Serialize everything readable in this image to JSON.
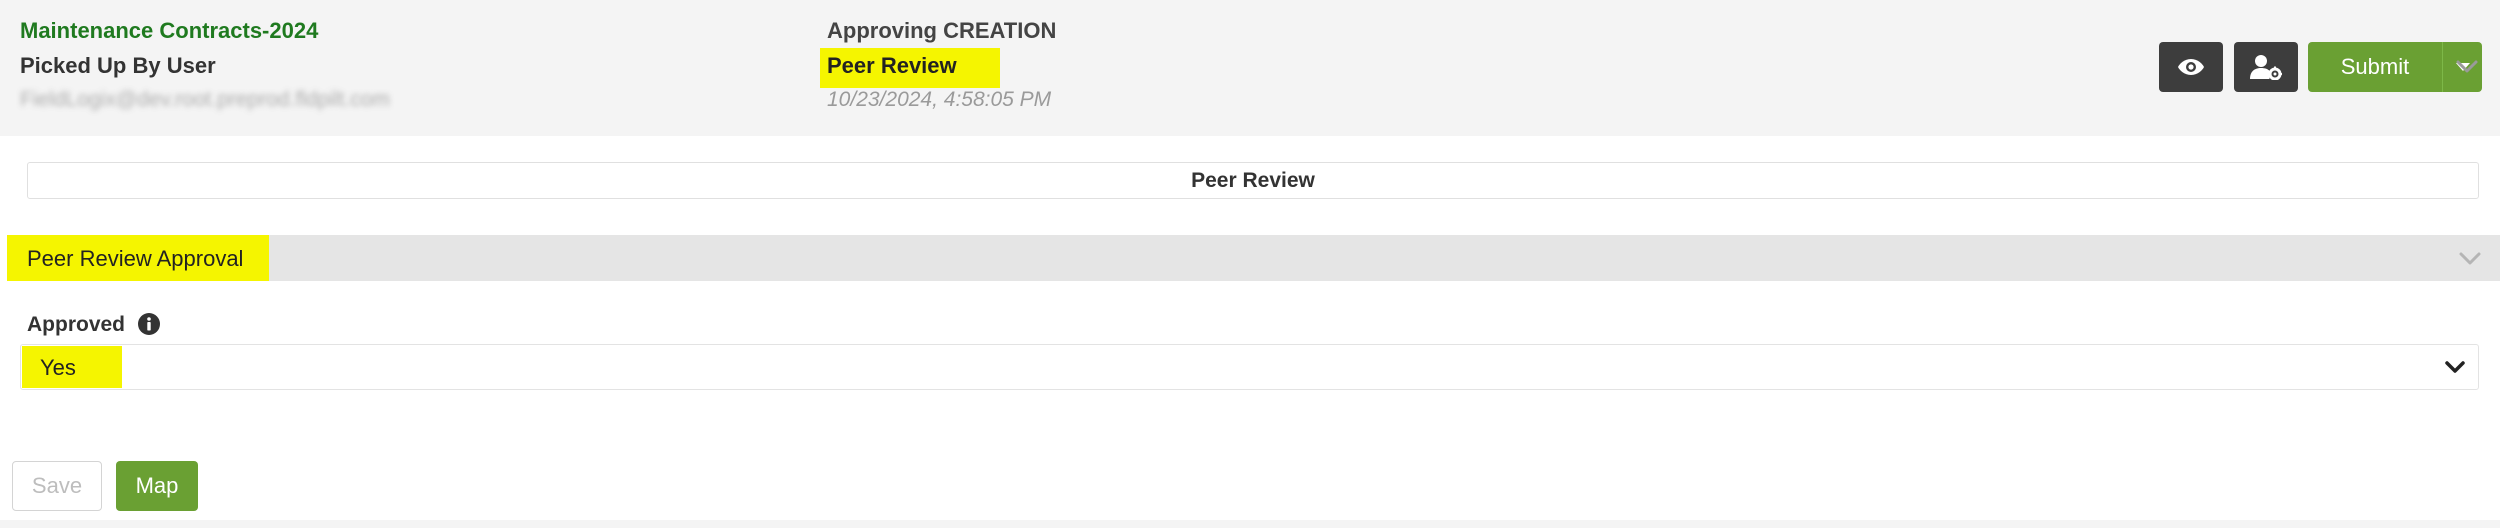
{
  "header": {
    "workflow_title": "Maintenance Contracts-2024",
    "status": "Picked Up By User",
    "user_email": "FieldLogix@dev.root.preprod.fldpilt.com",
    "approving_label": "Approving CREATION",
    "step_name": "Peer Review",
    "timestamp": "10/23/2024, 4:58:05 PM",
    "view_icon": "eye-icon",
    "reassign_icon": "user-gear-icon",
    "submit_label": "Submit"
  },
  "step_bar": {
    "label": "Peer Review"
  },
  "section": {
    "title": "Peer Review Approval"
  },
  "field": {
    "label": "Approved",
    "value": "Yes",
    "info_icon": "info-icon"
  },
  "footer": {
    "save_label": "Save",
    "map_label": "Map"
  },
  "colors": {
    "accent_green": "#6aa033",
    "title_green": "#1f7a1f",
    "dark_button": "#3d3d3d",
    "highlight": "#f5f500"
  }
}
